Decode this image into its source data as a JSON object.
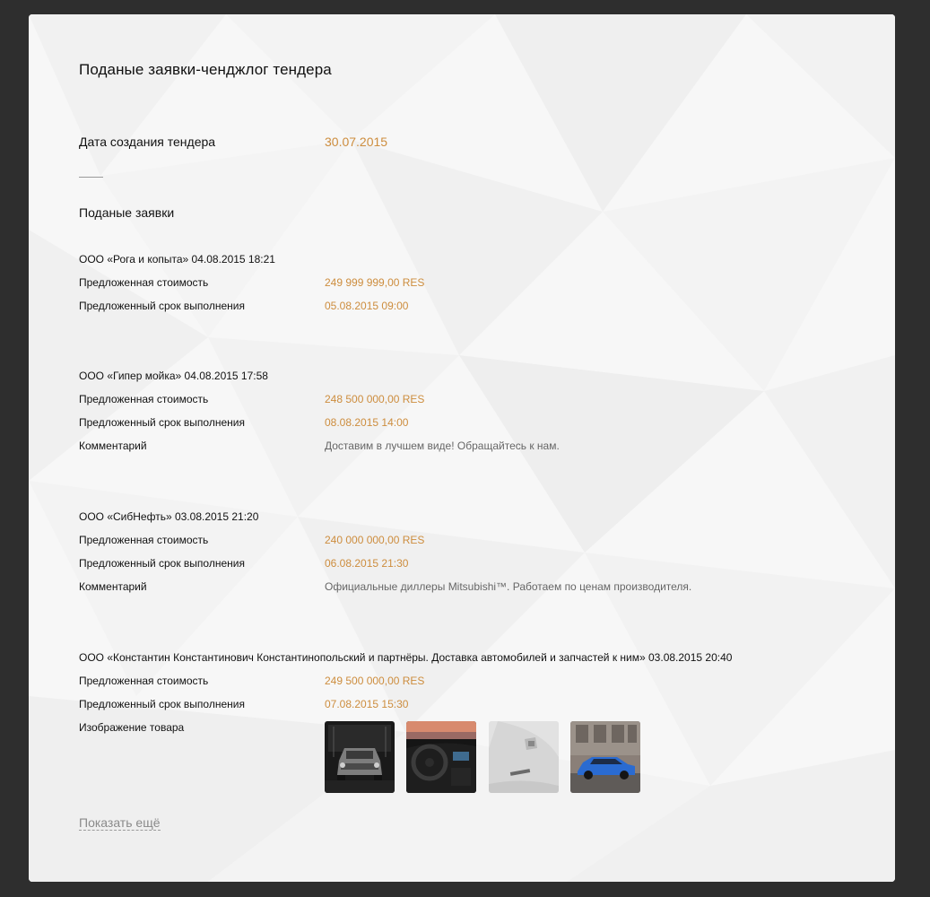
{
  "page": {
    "title": "Поданые заявки-ченджлог тендера",
    "created_label": "Дата создания тендера",
    "created_value": "30.07.2015",
    "section_title": "Поданые заявки",
    "show_more": "Показать ещё"
  },
  "colors": {
    "accent": "#cd8d3e",
    "text": "#111111",
    "muted": "#666666",
    "frame": "#2e2e2e"
  },
  "bids": [
    {
      "header": "ООО «Рога и копыта» 04.08.2015 18:21",
      "rows": [
        {
          "label": "Предложенная стоимость",
          "value": "249 999 999,00 RES",
          "style": "accent"
        },
        {
          "label": "Предложенный срок выполнения",
          "value": "05.08.2015 09:00",
          "style": "accent"
        }
      ]
    },
    {
      "header": "ООО «Гипер мойка» 04.08.2015 17:58",
      "rows": [
        {
          "label": "Предложенная стоимость",
          "value": "248 500 000,00 RES",
          "style": "accent"
        },
        {
          "label": "Предложенный срок выполнения",
          "value": "08.08.2015 14:00",
          "style": "accent"
        },
        {
          "label": "Комментарий",
          "value": "Доставим в лучшем виде! Обращайтесь к нам.",
          "style": "muted"
        }
      ]
    },
    {
      "header": "ООО «СибНефть» 03.08.2015 21:20",
      "rows": [
        {
          "label": "Предложенная стоимость",
          "value": "240 000 000,00 RES",
          "style": "accent"
        },
        {
          "label": "Предложенный срок выполнения",
          "value": "06.08.2015 21:30",
          "style": "accent"
        },
        {
          "label": "Комментарий",
          "value": "Официальные диллеры Mitsubishi™. Работаем по ценам производителя.",
          "style": "muted"
        }
      ]
    },
    {
      "header": "ООО «Константин Константинович Константинопольский и партнёры. Доставка автомобилей и запчастей к ним» 03.08.2015 20:40",
      "rows": [
        {
          "label": "Предложенная стоимость",
          "value": "249 500 000,00 RES",
          "style": "accent"
        },
        {
          "label": "Предложенный срок выполнения",
          "value": "07.08.2015 15:30",
          "style": "accent"
        },
        {
          "label": "Изображение товара",
          "type": "images",
          "images": [
            "car-front-showroom",
            "car-interior-dashboard",
            "car-rear-badge",
            "car-blue-side"
          ]
        }
      ]
    }
  ]
}
